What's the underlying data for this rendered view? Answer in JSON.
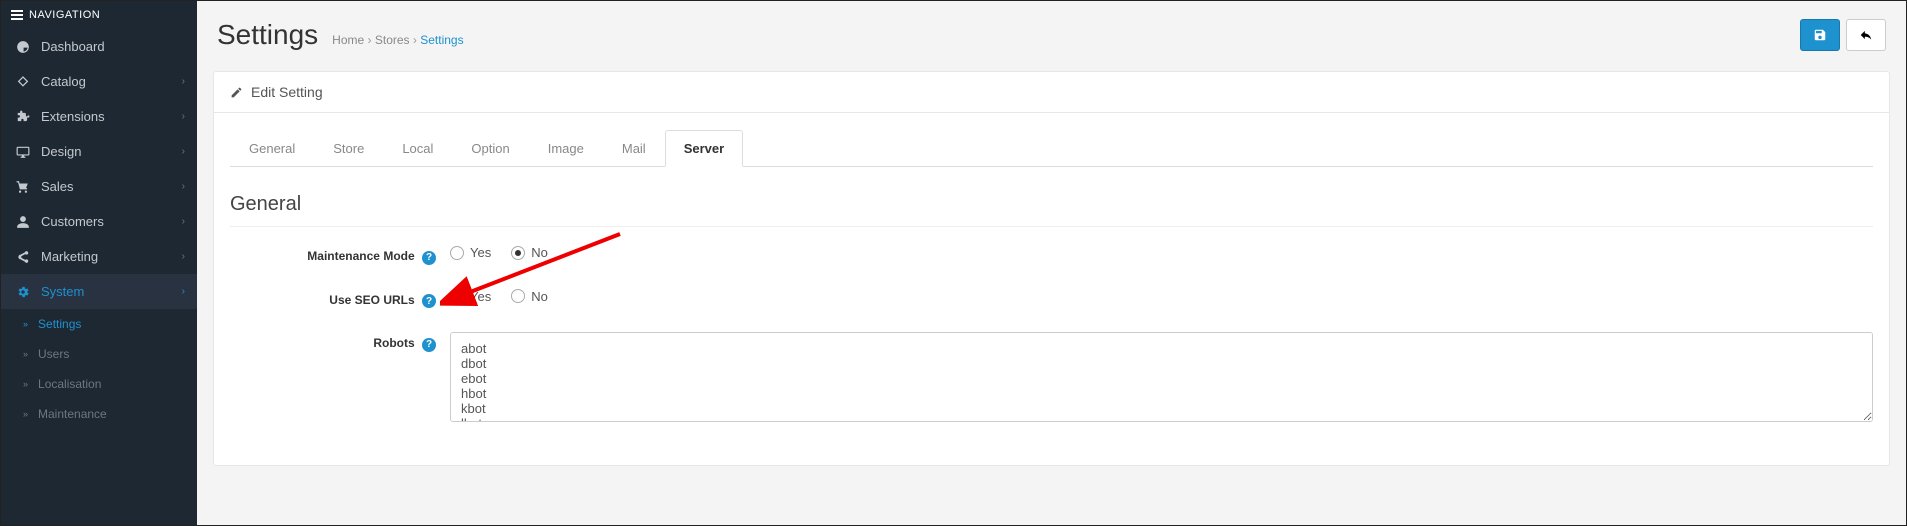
{
  "sidebar": {
    "header": "NAVIGATION",
    "items": [
      {
        "label": "Dashboard",
        "hasChildren": false
      },
      {
        "label": "Catalog",
        "hasChildren": true
      },
      {
        "label": "Extensions",
        "hasChildren": true
      },
      {
        "label": "Design",
        "hasChildren": true
      },
      {
        "label": "Sales",
        "hasChildren": true
      },
      {
        "label": "Customers",
        "hasChildren": true
      },
      {
        "label": "Marketing",
        "hasChildren": true
      },
      {
        "label": "System",
        "hasChildren": true,
        "active": true
      }
    ],
    "subItems": [
      {
        "label": "Settings",
        "active": true
      },
      {
        "label": "Users"
      },
      {
        "label": "Localisation"
      },
      {
        "label": "Maintenance"
      }
    ]
  },
  "header": {
    "title": "Settings",
    "breadcrumbs": [
      "Home",
      "Stores",
      "Settings"
    ]
  },
  "panel": {
    "heading": "Edit Setting"
  },
  "tabs": [
    "General",
    "Store",
    "Local",
    "Option",
    "Image",
    "Mail",
    "Server"
  ],
  "activeTab": "Server",
  "section": {
    "title": "General"
  },
  "form": {
    "maintenance": {
      "label": "Maintenance Mode",
      "options": {
        "yes": "Yes",
        "no": "No"
      },
      "value": "no"
    },
    "seo": {
      "label": "Use SEO URLs",
      "options": {
        "yes": "Yes",
        "no": "No"
      },
      "value": "yes"
    },
    "robots": {
      "label": "Robots",
      "value": "abot\ndbot\nebot\nhbot\nkbot\nlbot"
    }
  }
}
